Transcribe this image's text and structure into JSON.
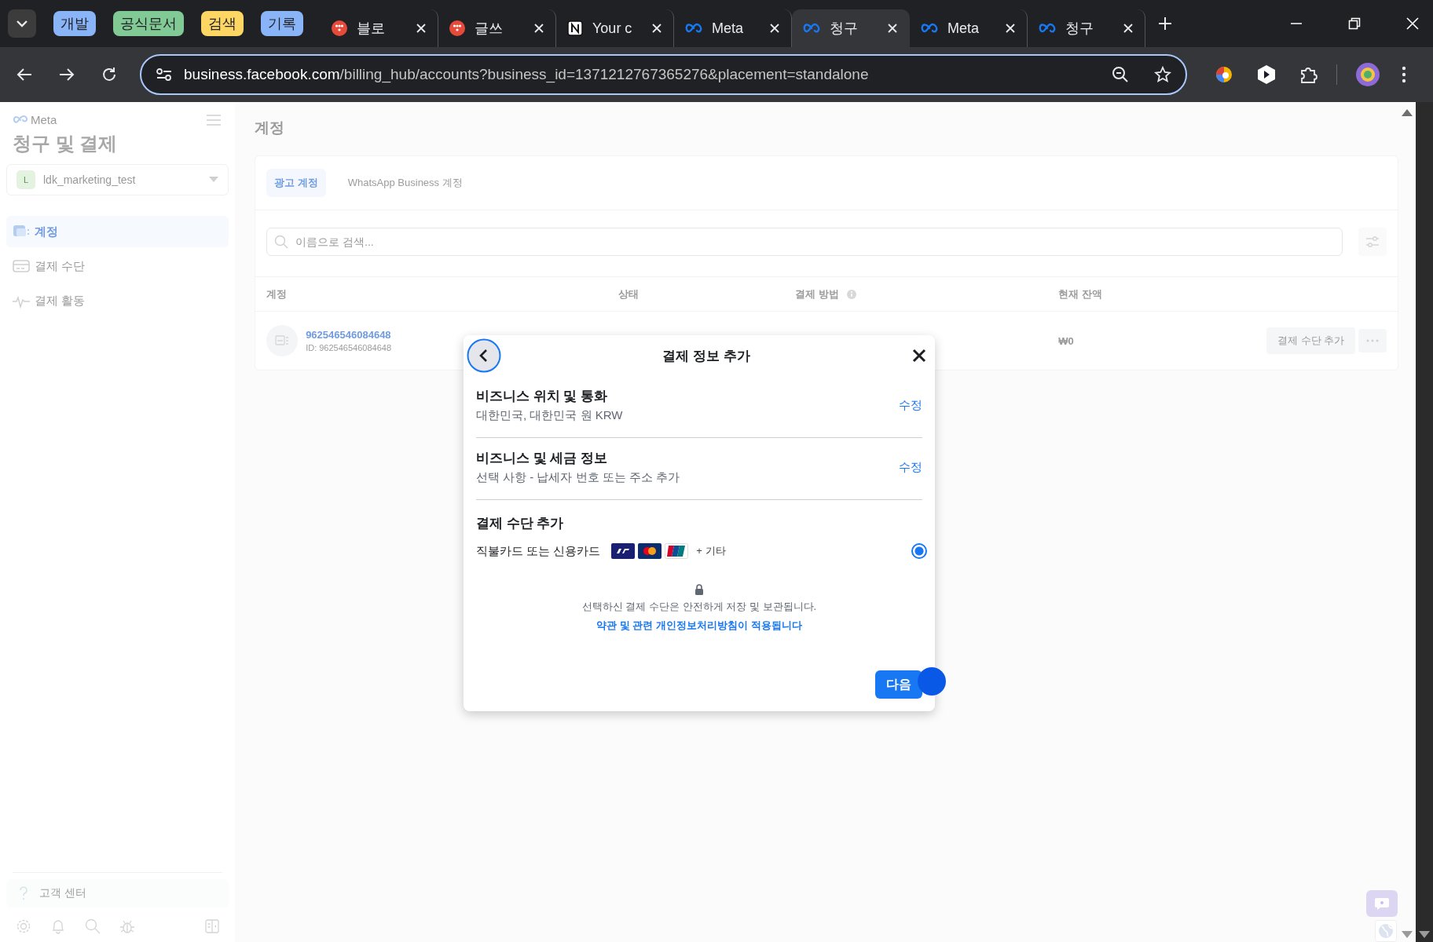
{
  "browser": {
    "tab_groups": [
      {
        "label": "개발",
        "color": "#8ab4f8"
      },
      {
        "label": "공식문서",
        "color": "#81c995"
      },
      {
        "label": "검색",
        "color": "#fdd663"
      },
      {
        "label": "기록",
        "color": "#8ab4f8"
      }
    ],
    "tabs": [
      {
        "title": "블로",
        "kind": "dot-logo",
        "selected": false
      },
      {
        "title": "글쓰",
        "kind": "dot-logo",
        "selected": false
      },
      {
        "title": "Your c",
        "kind": "page-logo",
        "selected": false
      },
      {
        "title": "Meta",
        "kind": "infinity-logo",
        "selected": false
      },
      {
        "title": "청구",
        "kind": "infinity-logo",
        "selected": true
      },
      {
        "title": "Meta",
        "kind": "infinity-logo",
        "selected": false
      },
      {
        "title": "청구",
        "kind": "infinity-logo",
        "selected": false
      }
    ],
    "url_host": "business.facebook.com",
    "url_path": "/billing_hub/accounts?business_id=1371212767365276&placement=standalone"
  },
  "sidebar": {
    "brand": "Meta",
    "title": "청구 및 결제",
    "account": {
      "initial": "L",
      "name": "ldk_marketing_test"
    },
    "nav": [
      {
        "label": "계정",
        "selected": true
      },
      {
        "label": "결제 수단",
        "selected": false
      },
      {
        "label": "결제 활동",
        "selected": false
      }
    ],
    "help": "고객 센터"
  },
  "main": {
    "title": "계정",
    "tabs": [
      {
        "label": "광고 계정",
        "selected": true
      },
      {
        "label": "WhatsApp Business 계정",
        "selected": false
      }
    ],
    "search": {
      "placeholder": "이름으로 검색..."
    },
    "columns": [
      "계정",
      "상태",
      "결제 방법",
      "현재 잔액"
    ],
    "rows": [
      {
        "name": "962546546084648",
        "id": "ID: 962546546084648",
        "balance": "₩0",
        "action": "결제 수단 추가"
      }
    ]
  },
  "modal": {
    "title": "결제 정보 추가",
    "sections": [
      {
        "title": "비즈니스 위치 및 통화",
        "subtitle": "대한민국, 대한민국 원 KRW",
        "action": "수정"
      },
      {
        "title": "비즈니스 및 세금 정보",
        "subtitle": "선택 사항 - 납세자 번호 또는 주소 추가",
        "action": "수정"
      }
    ],
    "payment": {
      "title": "결제 수단 추가",
      "option": {
        "label": "직불카드 또는 신용카드",
        "more": "+ 기타",
        "selected": true
      }
    },
    "secure_note": "선택하신 결제 수단은 안전하게 저장 및 보관됩니다.",
    "policy_link": "약관 및 관련 개인정보처리방침이 적용됩니다",
    "next_button": "다음"
  }
}
